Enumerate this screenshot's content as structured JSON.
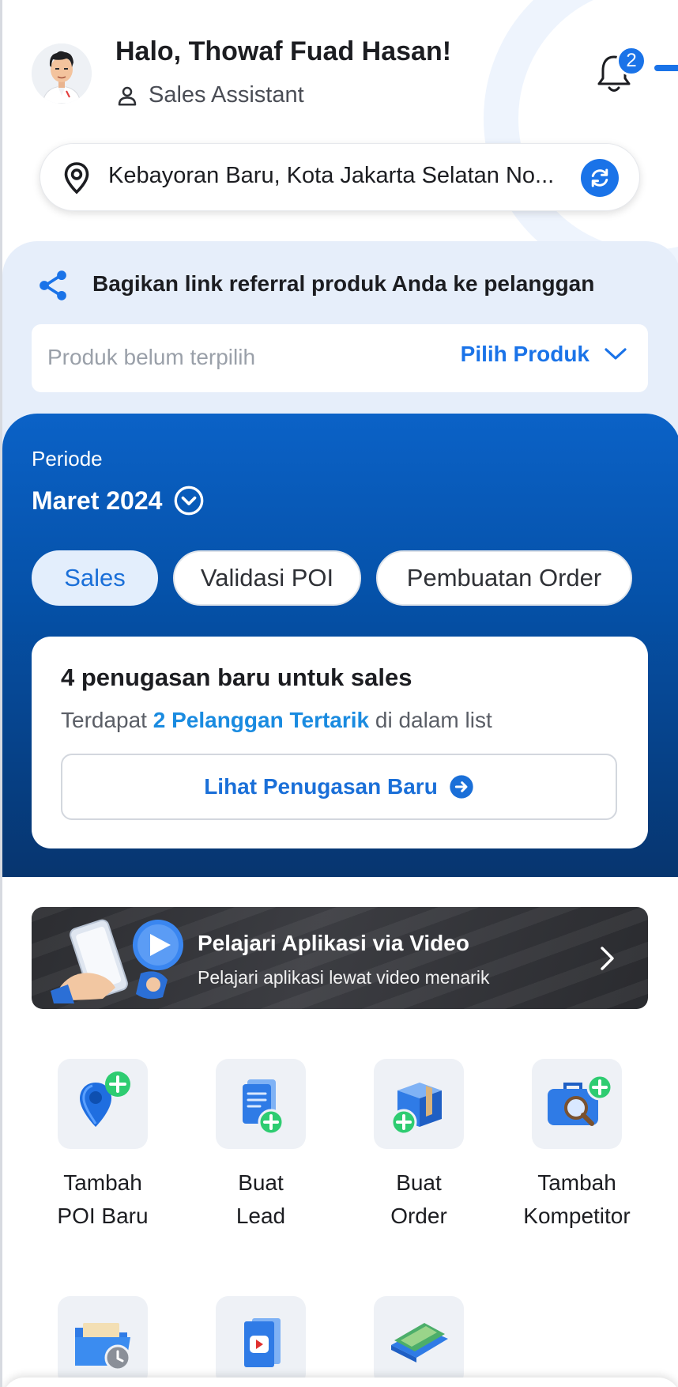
{
  "header": {
    "greeting": "Halo, Thowaf Fuad Hasan!",
    "role": "Sales Assistant",
    "notification_count": "2"
  },
  "location": {
    "text": "Kebayoran Baru, Kota Jakarta Selatan No..."
  },
  "referral": {
    "title": "Bagikan link referral produk Anda ke pelanggan",
    "placeholder": "Produk belum terpilih",
    "pick_label": "Pilih Produk"
  },
  "period": {
    "label": "Periode",
    "value": "Maret 2024"
  },
  "tabs": [
    {
      "label": "Sales",
      "active": true
    },
    {
      "label": "Validasi POI",
      "active": false
    },
    {
      "label": "Pembuatan Order",
      "active": false
    }
  ],
  "task_card": {
    "title": "4 penugasan baru untuk sales",
    "sub_prefix": "Terdapat ",
    "sub_highlight": "2 Pelanggan Tertarik",
    "sub_suffix": " di dalam list",
    "button_label": "Lihat Penugasan Baru"
  },
  "video_banner": {
    "title": "Pelajari Aplikasi via Video",
    "subtitle": "Pelajari aplikasi lewat video menarik"
  },
  "menu": [
    {
      "line1": "Tambah",
      "line2": "POI Baru",
      "icon": "add-poi-icon"
    },
    {
      "line1": "Buat",
      "line2": "Lead",
      "icon": "create-lead-icon"
    },
    {
      "line1": "Buat",
      "line2": "Order",
      "icon": "create-order-icon"
    },
    {
      "line1": "Tambah",
      "line2": "Kompetitor",
      "icon": "add-competitor-icon"
    },
    {
      "icon": "folder-history-icon"
    },
    {
      "icon": "video-book-icon"
    },
    {
      "icon": "catalog-book-icon"
    }
  ],
  "colors": {
    "primary": "#1a73e8",
    "panel_top": "#0b62c7",
    "panel_bottom": "#07356f",
    "accent_green": "#2ecc71"
  }
}
